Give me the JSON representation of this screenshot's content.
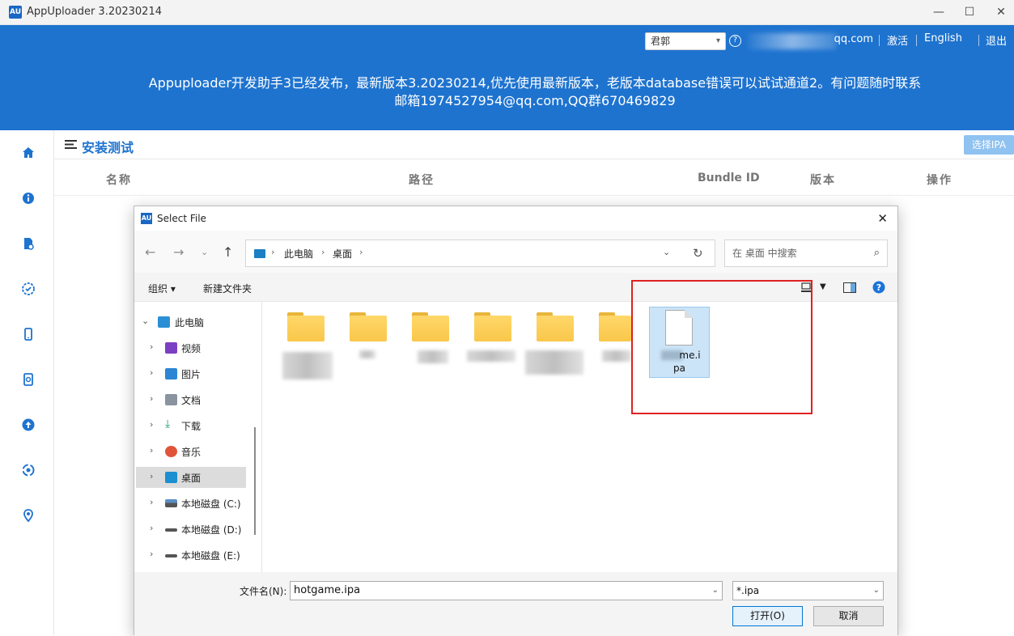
{
  "window": {
    "title": "AppUploader 3.20230214",
    "logo": "AU"
  },
  "header": {
    "lang_select": "君郭",
    "user_suffix": "qq.com",
    "activate": "激活",
    "english": "English",
    "logout": "退出",
    "notice_line1": "Appuploader开发助手3已经发布，最新版本3.20230214,优先使用最新版本，老版本database错误可以试试通道2。有问题随时联系",
    "notice_line2": "邮箱1974527954@qq.com,QQ群670469829"
  },
  "sidebar": {
    "icons": [
      "home-icon",
      "info-icon",
      "certificate-icon",
      "check-badge-icon",
      "phone-icon",
      "device-refresh-icon",
      "upload-icon",
      "sync-icon",
      "location-icon"
    ]
  },
  "page": {
    "title": "安装测试",
    "select_ipa": "选择IPA"
  },
  "table": {
    "columns": [
      "名称",
      "路径",
      "Bundle ID",
      "版本",
      "操作"
    ]
  },
  "dialog": {
    "title": "Select File",
    "logo": "AU",
    "breadcrumb": [
      "此电脑",
      "桌面"
    ],
    "search_placeholder": "在 桌面 中搜索",
    "toolbar": {
      "organize": "组织 ▾",
      "new_folder": "新建文件夹"
    },
    "tree": [
      {
        "label": "此电脑",
        "icon": "computer-icon"
      },
      {
        "label": "视频",
        "icon": "video-icon"
      },
      {
        "label": "图片",
        "icon": "pictures-icon"
      },
      {
        "label": "文档",
        "icon": "documents-icon"
      },
      {
        "label": "下载",
        "icon": "download-icon"
      },
      {
        "label": "音乐",
        "icon": "music-icon"
      },
      {
        "label": "桌面",
        "icon": "desktop-icon"
      },
      {
        "label": "本地磁盘 (C:)",
        "icon": "drive-icon"
      },
      {
        "label": "本地磁盘 (D:)",
        "icon": "drive-icon"
      },
      {
        "label": "本地磁盘 (E:)",
        "icon": "drive-icon"
      }
    ],
    "selected_file": {
      "line1": "me.i",
      "line2": "pa"
    },
    "filename_label": "文件名(N):",
    "filename_value": "hotgame.ipa",
    "filetype": "*.ipa",
    "open_button": "打开(O)",
    "cancel_button": "取消"
  }
}
